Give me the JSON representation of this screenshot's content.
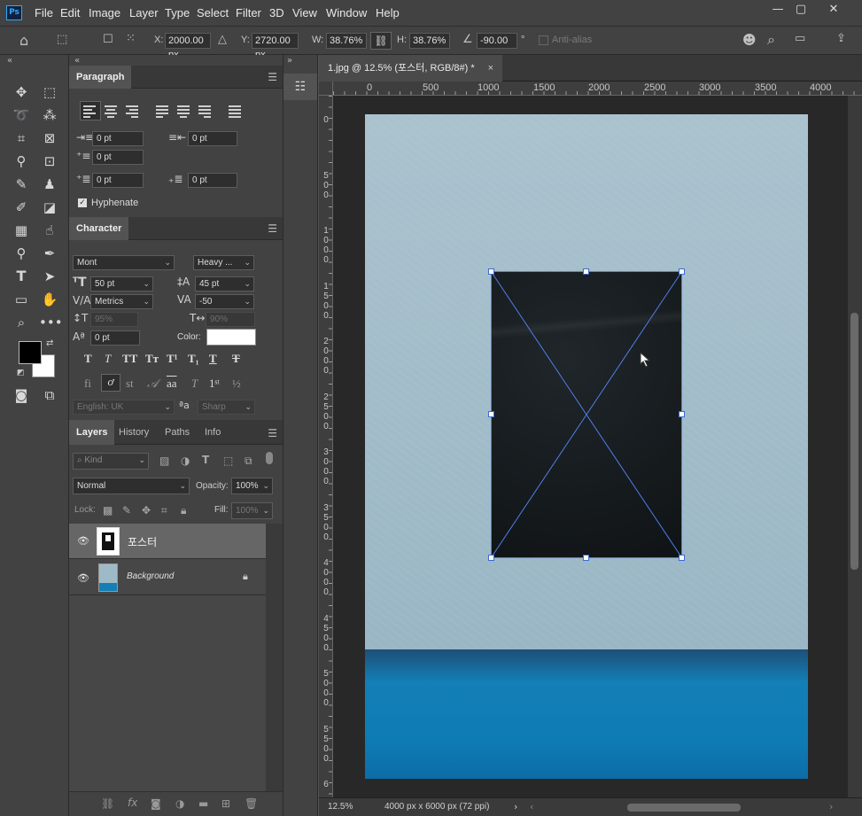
{
  "menu": [
    "File",
    "Edit",
    "Image",
    "Layer",
    "Type",
    "Select",
    "Filter",
    "3D",
    "View",
    "Window",
    "Help"
  ],
  "app_logo": "Ps",
  "options": {
    "x_label": "X:",
    "x_value": "2000.00 px",
    "y_label": "Y:",
    "y_value": "2720.00 px",
    "w_label": "W:",
    "w_value": "38.76%",
    "h_label": "H:",
    "h_value": "38.76%",
    "angle_value": "-90.00",
    "angle_unit": "°",
    "anti_alias": "Anti-alias"
  },
  "paragraph": {
    "tab": "Paragraph",
    "indent_left": "0 pt",
    "indent_right": "0 pt",
    "indent_first": "0 pt",
    "space_before": "0 pt",
    "space_after": "0 pt",
    "hyphenate": "Hyphenate"
  },
  "character": {
    "tab": "Character",
    "font_family": "Mont",
    "font_style": "Heavy ...",
    "font_size": "50 pt",
    "leading": "45 pt",
    "kerning": "Metrics",
    "tracking": "-50",
    "vscale": "95%",
    "hscale": "90%",
    "baseline": "0 pt",
    "color_label": "Color:",
    "color": "#ffffff",
    "language": "English: UK",
    "antialias": "Sharp",
    "aa_label": "ªa"
  },
  "layers": {
    "tabs": [
      "Layers",
      "History",
      "Paths",
      "Info"
    ],
    "filter_kind": "Kind",
    "blend_mode": "Normal",
    "opacity_label": "Opacity:",
    "opacity": "100%",
    "lock_label": "Lock:",
    "fill_label": "Fill:",
    "fill": "100%",
    "items": [
      {
        "name": "포스터",
        "selected": true
      },
      {
        "name": "Background",
        "selected": false
      }
    ]
  },
  "document": {
    "tab_title": "1.jpg @ 12.5% (포스터, RGB/8#) *",
    "close": "×",
    "ruler_h": [
      "0",
      "500",
      "1000",
      "1500",
      "2000",
      "2500",
      "3000",
      "3500",
      "4000"
    ],
    "ruler_v": [
      "0",
      "5 0 0",
      "1 0 0 0",
      "1 5 0 0",
      "2 0 0 0",
      "2 5 0 0",
      "3 0 0 0",
      "3 5 0 0",
      "4 0 0 0",
      "4 5 0 0",
      "5 0 0 0",
      "5 5 0 0",
      "6"
    ]
  },
  "status": {
    "zoom": "12.5%",
    "doc_info": "4000 px x 6000 px (72 ppi)"
  }
}
